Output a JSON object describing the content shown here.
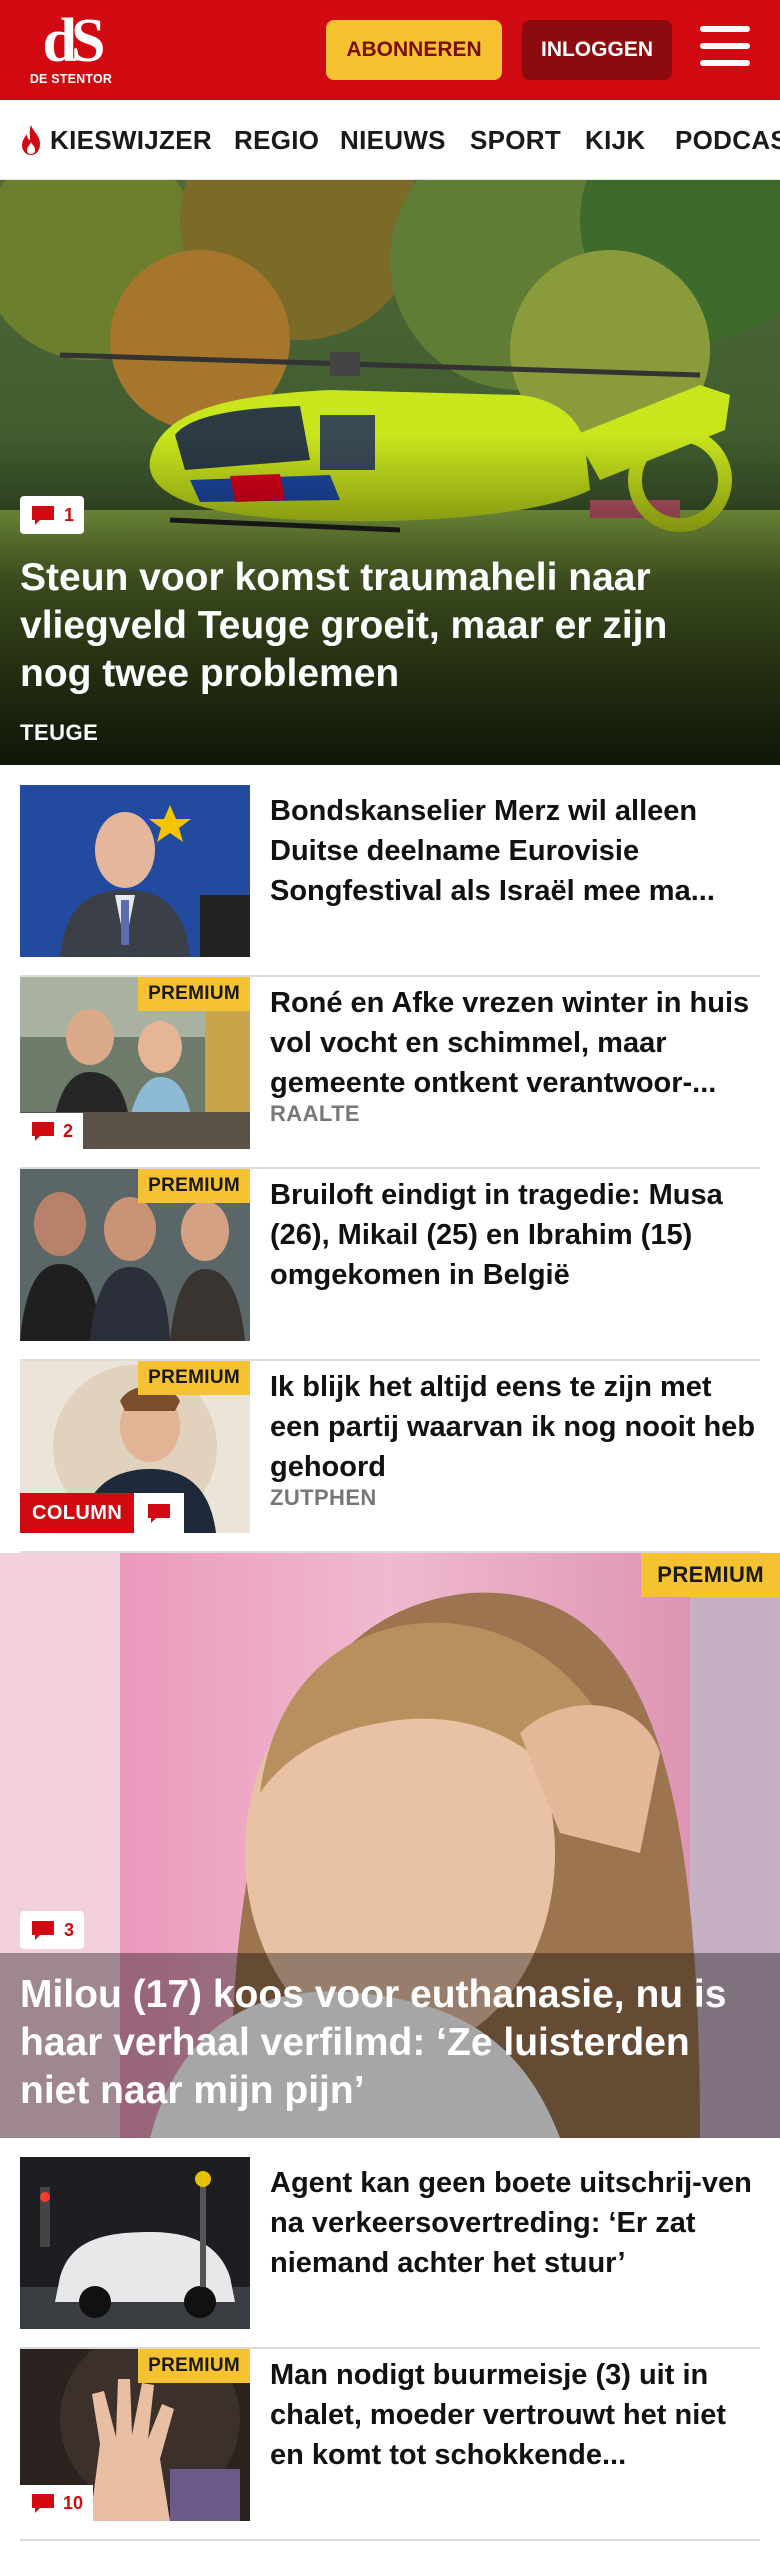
{
  "header": {
    "logo_mark": "dS",
    "logo_name": "DE STENTOR",
    "subscribe_label": "ABONNEREN",
    "login_label": "INLOGGEN",
    "brand_color": "#d10a11",
    "accent_color": "#f5c232"
  },
  "nav": {
    "items": [
      "KIESWIJZER",
      "REGIO",
      "NIEUWS",
      "SPORT",
      "KIJK",
      "PODCAST"
    ]
  },
  "hero": {
    "comments": "1",
    "title": "Steun voor komst traumaheli naar vliegveld Teuge groeit, maar er zijn nog twee problemen",
    "tag": "TEUGE"
  },
  "articles": [
    {
      "title": "Bondskanselier Merz wil alleen Duitse deelname Eurovisie Songfestival als Israël mee ma..."
    },
    {
      "premium": "PREMIUM",
      "comments": "2",
      "title": "Roné en Afke vrezen winter in huis vol vocht en schimmel, maar gemeente ontkent verantwoor-...",
      "tag": "RAALTE"
    },
    {
      "premium": "PREMIUM",
      "title": "Bruiloft eindigt in tragedie: Musa (26), Mikail (25) en Ibrahim (15) omgekomen in België"
    },
    {
      "premium": "PREMIUM",
      "column": "COLUMN",
      "title": "Ik blijk het altijd eens te zijn met een partij waarvan ik nog nooit heb gehoord",
      "tag": "ZUTPHEN"
    }
  ],
  "feature": {
    "premium": "PREMIUM",
    "comments": "3",
    "title": "Milou (17) koos voor euthanasie, nu is haar verhaal verfilmd: ‘Ze luisterden niet naar mijn pijn’"
  },
  "articles2": [
    {
      "title": "Agent kan geen boete uitschrij-ven na verkeersovertreding: ‘Er zat niemand achter het stuur’"
    },
    {
      "premium": "PREMIUM",
      "comments": "10",
      "title": "Man nodigt buurmeisje (3) uit in chalet, moeder vertrouwt het niet en komt tot schokkende..."
    }
  ]
}
